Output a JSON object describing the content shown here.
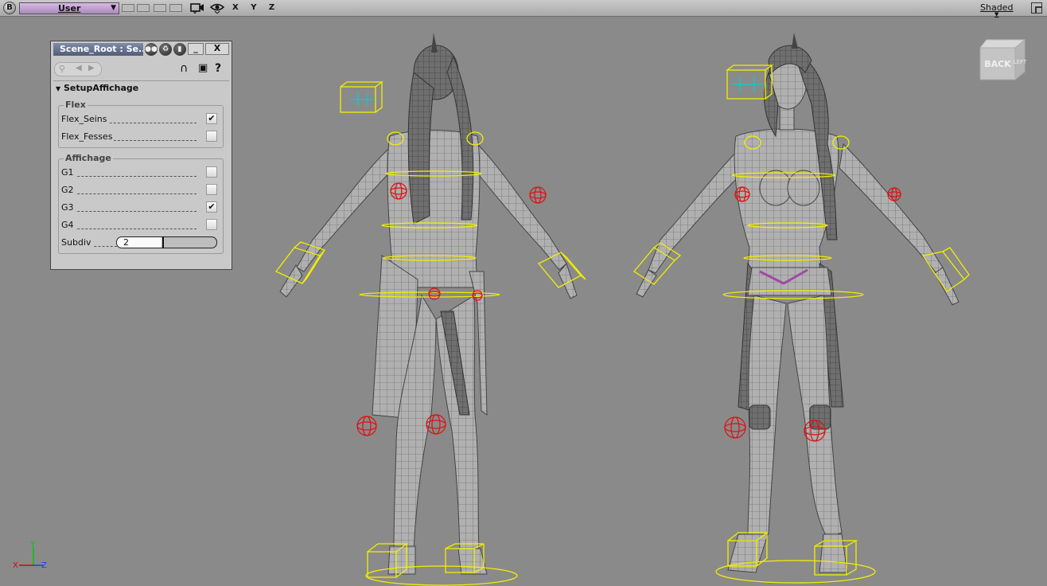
{
  "toolbar": {
    "logo": "B",
    "camera": "User",
    "axes": "X Y Z",
    "display_mode": "Shaded",
    "camera_icon": "camera-icon",
    "eye_icon": "eye-icon"
  },
  "viewcube": {
    "face_front": "BACK",
    "face_side": "LEFT"
  },
  "panel": {
    "title": "Scene_Root : Se...",
    "min_label": "_",
    "close_label": "X",
    "section": "SetupAffichage",
    "flex": {
      "label": "Flex",
      "items": [
        {
          "label": "Flex_Seins",
          "checked": "✔"
        },
        {
          "label": "Flex_Fesses",
          "checked": ""
        }
      ]
    },
    "affichage": {
      "label": "Affichage",
      "items": [
        {
          "label": "G1",
          "checked": ""
        },
        {
          "label": "G2",
          "checked": ""
        },
        {
          "label": "G3",
          "checked": "✔"
        },
        {
          "label": "G4",
          "checked": ""
        }
      ],
      "subdiv_label": "Subdiv",
      "subdiv_value": "2"
    }
  },
  "axis_gizmo": {
    "x": "X",
    "y": "Y",
    "z": "Z"
  },
  "colors": {
    "selection": "#f2ee00",
    "effector": "#e01010",
    "wire": "#555555"
  }
}
